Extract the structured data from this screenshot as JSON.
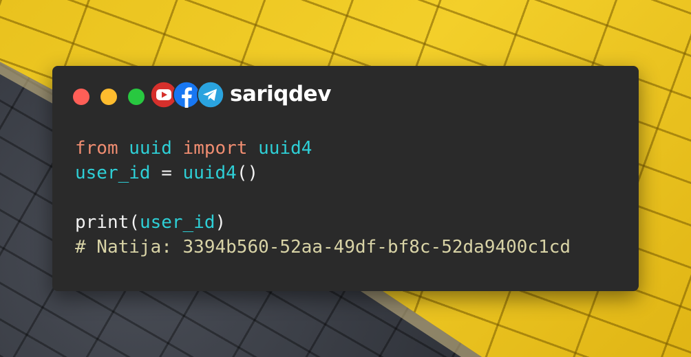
{
  "brand": {
    "name": "sariqdev",
    "social_icons": [
      "youtube-icon",
      "facebook-icon",
      "telegram-icon"
    ]
  },
  "window_controls": {
    "close_color": "#ff5f57",
    "minimize_color": "#febc2e",
    "maximize_color": "#28c840"
  },
  "colors": {
    "keyword": "#f08d71",
    "identifier": "#2ecfd6",
    "plain": "#f2f2f2",
    "comment": "#d8d3a6",
    "window_bg": "#2a2a2a"
  },
  "code": {
    "line1": {
      "kw1": "from",
      "mod": "uuid",
      "kw2": "import",
      "name": "uuid4"
    },
    "line2": {
      "var": "user_id",
      "op": "=",
      "call": "uuid4",
      "parens": "()"
    },
    "line4": {
      "fn": "print",
      "open": "(",
      "arg": "user_id",
      "close": ")"
    },
    "line5": {
      "comment": "# Natija: 3394b560-52aa-49df-bf8c-52da9400c1cd"
    }
  }
}
